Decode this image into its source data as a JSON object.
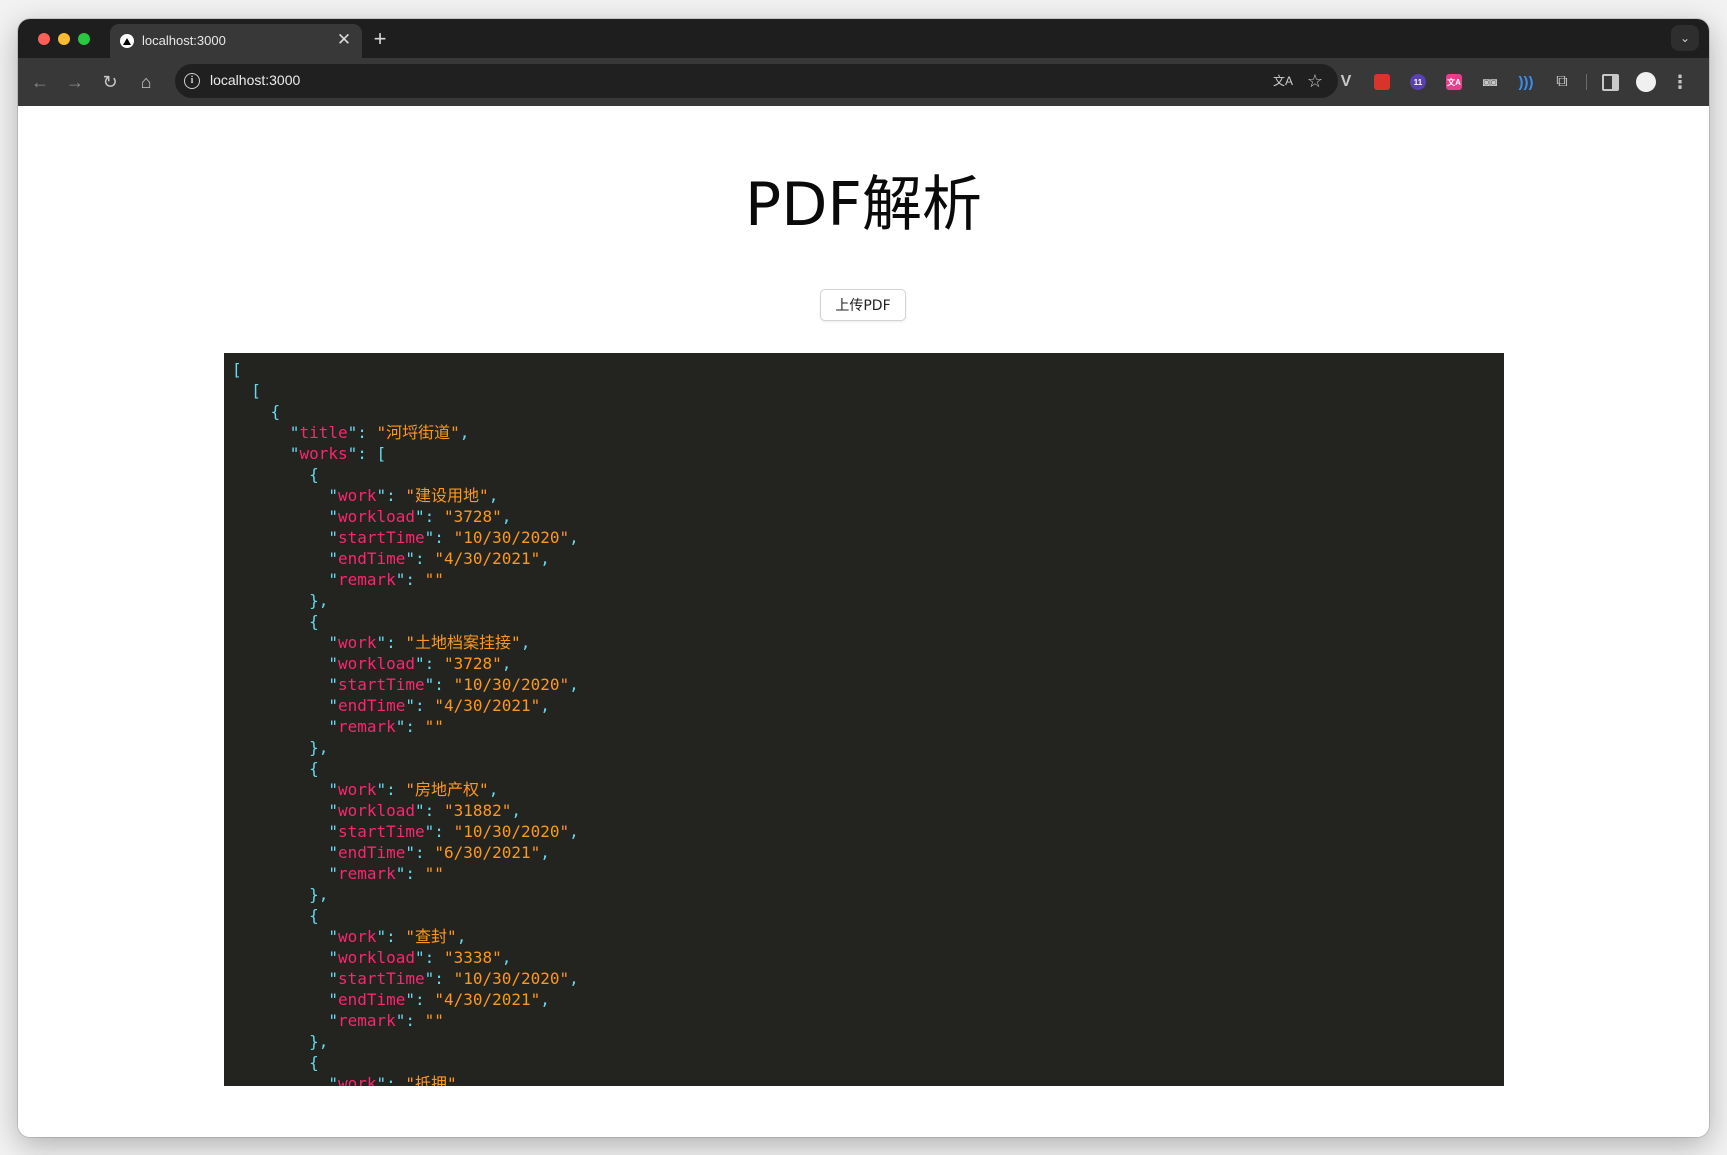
{
  "browser": {
    "tab_title": "localhost:3000",
    "tab_close_glyph": "✕",
    "new_tab_glyph": "+",
    "url": "localhost:3000",
    "ext_badge_purple": "11",
    "ext_badge_pink": "文A"
  },
  "page": {
    "title": "PDF解析",
    "upload_button": "上传PDF"
  },
  "json_output": [
    [
      {
        "title": "河埒街道",
        "works": [
          {
            "work": "建设用地",
            "workload": "3728",
            "startTime": "10/30/2020",
            "endTime": "4/30/2021",
            "remark": ""
          },
          {
            "work": "土地档案挂接",
            "workload": "3728",
            "startTime": "10/30/2020",
            "endTime": "4/30/2021",
            "remark": ""
          },
          {
            "work": "房地产权",
            "workload": "31882",
            "startTime": "10/30/2020",
            "endTime": "6/30/2021",
            "remark": ""
          },
          {
            "work": "查封",
            "workload": "3338",
            "startTime": "10/30/2020",
            "endTime": "4/30/2021",
            "remark": ""
          },
          {
            "work": "抵押"
          }
        ]
      }
    ]
  ],
  "colors": {
    "code_bg": "#23241f",
    "punctuation": "#66d9ef",
    "key": "#f92672",
    "string": "#fd971f"
  }
}
